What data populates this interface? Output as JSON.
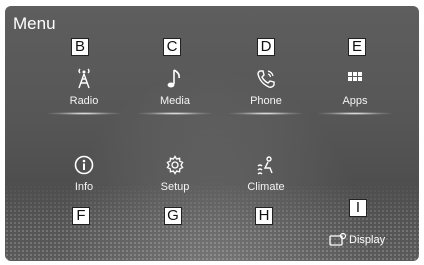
{
  "screen": {
    "title": "Menu"
  },
  "tiles": [
    {
      "label": "Radio",
      "icon": "antenna-icon",
      "callout": "B"
    },
    {
      "label": "Media",
      "icon": "music-note-icon",
      "callout": "C"
    },
    {
      "label": "Phone",
      "icon": "phone-icon",
      "callout": "D"
    },
    {
      "label": "Apps",
      "icon": "apps-grid-icon",
      "callout": "E"
    },
    {
      "label": "Info",
      "icon": "info-icon",
      "callout": "F"
    },
    {
      "label": "Setup",
      "icon": "gear-icon",
      "callout": "G"
    },
    {
      "label": "Climate",
      "icon": "climate-icon",
      "callout": "H"
    }
  ],
  "display_button": {
    "label": "Display",
    "icon": "display-icon",
    "callout": "I"
  },
  "colors": {
    "background": "#565656",
    "text": "#ffffff",
    "callout_bg": "#ffffff"
  }
}
